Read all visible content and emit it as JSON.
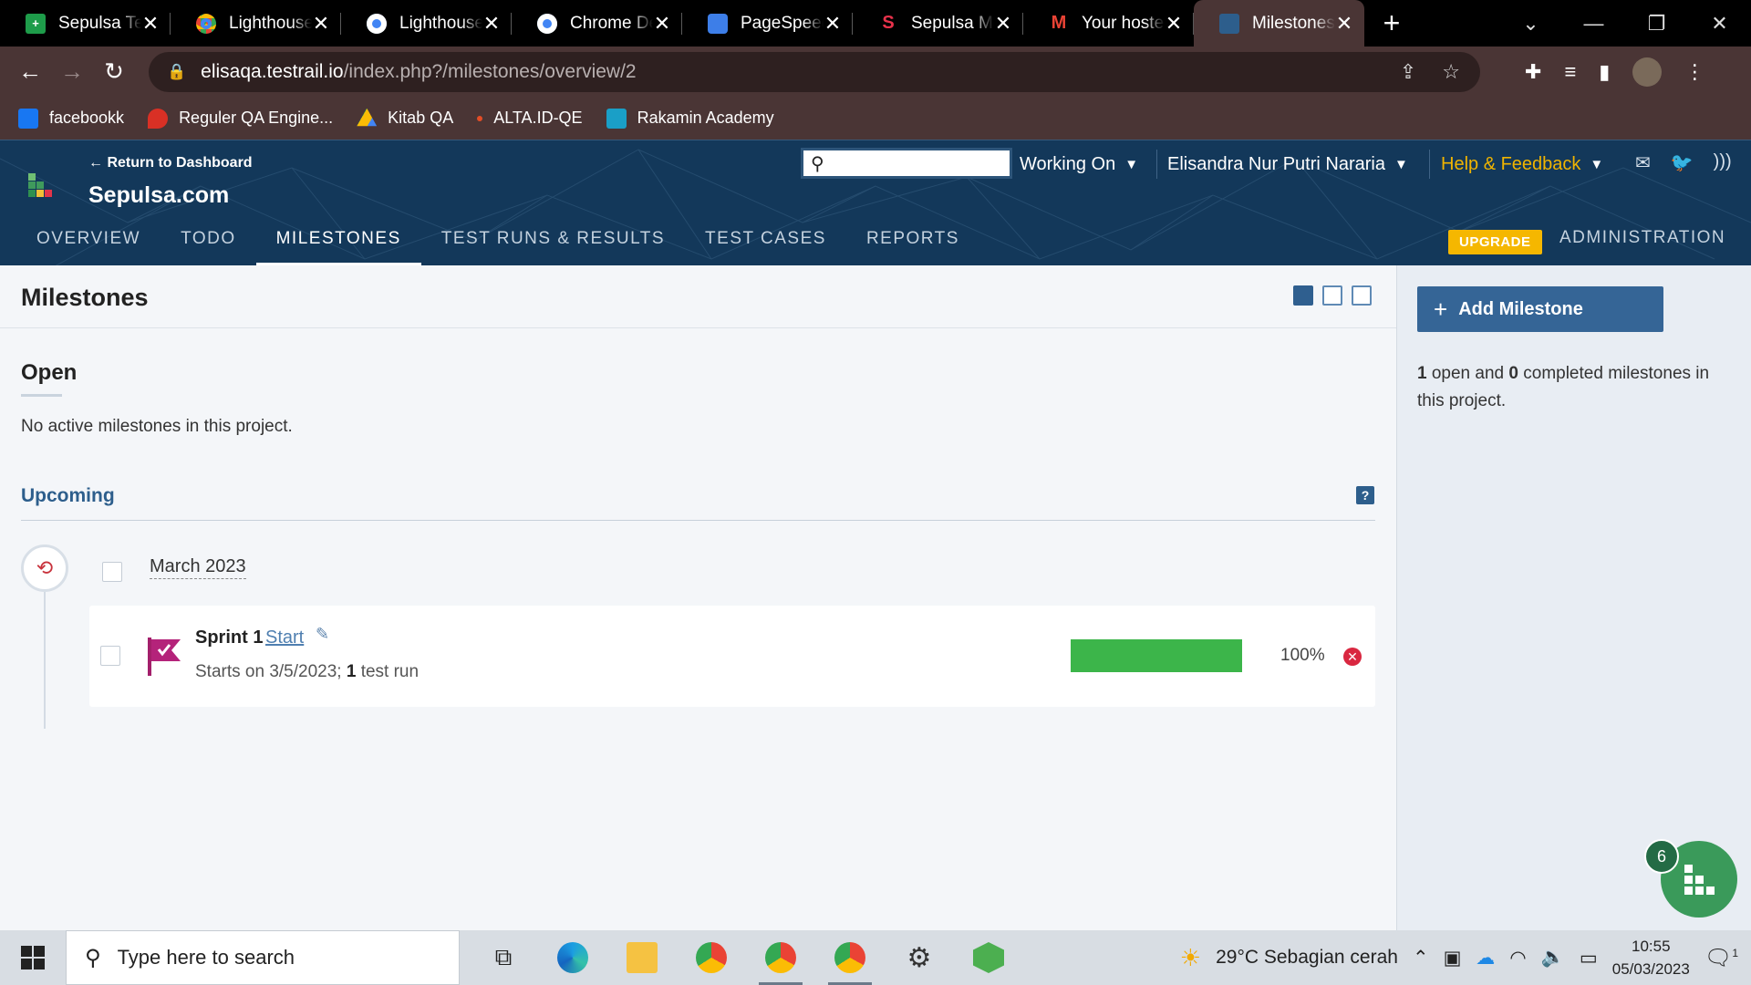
{
  "browser": {
    "tabs": [
      {
        "title": "Sepulsa Test",
        "favicon_color": "#1e9c4a",
        "favicon_glyph": "+"
      },
      {
        "title": "Lighthouse",
        "favicon_color": "#4285f4",
        "favicon_glyph": ""
      },
      {
        "title": "Lighthouse",
        "favicon_color": "#4285f4",
        "favicon_glyph": ""
      },
      {
        "title": "Chrome De",
        "favicon_color": "#4285f4",
        "favicon_glyph": ""
      },
      {
        "title": "PageSpeed",
        "favicon_color": "#3d7ee8",
        "favicon_glyph": ""
      },
      {
        "title": "Sepulsa Mc",
        "favicon_color": "#e8324b",
        "favicon_glyph": "S"
      },
      {
        "title": "Your hostec",
        "favicon_color": "#ea4335",
        "favicon_glyph": "M"
      },
      {
        "title": "Milestones",
        "favicon_color": "#2d5e8c",
        "favicon_glyph": ""
      }
    ],
    "url_host": "elisaqa.testrail.io",
    "url_path": "/index.php?/milestones/overview/2",
    "bookmarks": [
      {
        "label": "facebookk",
        "color": "#1877f2"
      },
      {
        "label": "Reguler QA Engine...",
        "color": "#d93025"
      },
      {
        "label": "Kitab QA",
        "color": "#f4b400"
      },
      {
        "label": "ALTA.ID-QE",
        "color": "#e44d26"
      },
      {
        "label": "Rakamin Academy",
        "color": "#1a9fc7"
      }
    ]
  },
  "header": {
    "return_link": "← Return to Dashboard",
    "project_name": "Sepulsa.com",
    "search_placeholder": "",
    "working_on": "Working On",
    "user_name": "Elisandra Nur Putri Nararia",
    "help": "Help & Feedback",
    "upgrade": "UPGRADE",
    "administration": "ADMINISTRATION",
    "nav": [
      "OVERVIEW",
      "TODO",
      "MILESTONES",
      "TEST RUNS & RESULTS",
      "TEST CASES",
      "REPORTS"
    ],
    "active_nav": "MILESTONES"
  },
  "main": {
    "title": "Milestones",
    "open_heading": "Open",
    "no_active": "No active milestones in this project.",
    "upcoming_heading": "Upcoming",
    "help_glyph": "?",
    "group_label": "March 2023",
    "milestone": {
      "name": "Sprint 1",
      "start_link": "Start",
      "starts_on": "Starts on 3/5/2023;",
      "run_count": "1",
      "run_label": "test run",
      "progress": 1.0,
      "progress_label": "100%"
    }
  },
  "sidebar": {
    "add_button": "Add Milestone",
    "open_count": "1",
    "open_text": "open and",
    "completed_count": "0",
    "completed_text": "completed milestones in this project."
  },
  "fab": {
    "badge": "6"
  },
  "taskbar": {
    "search_placeholder": "Type here to search",
    "weather": "29°C  Sebagian cerah",
    "time": "10:55",
    "date": "05/03/2023",
    "notifications": "1"
  }
}
